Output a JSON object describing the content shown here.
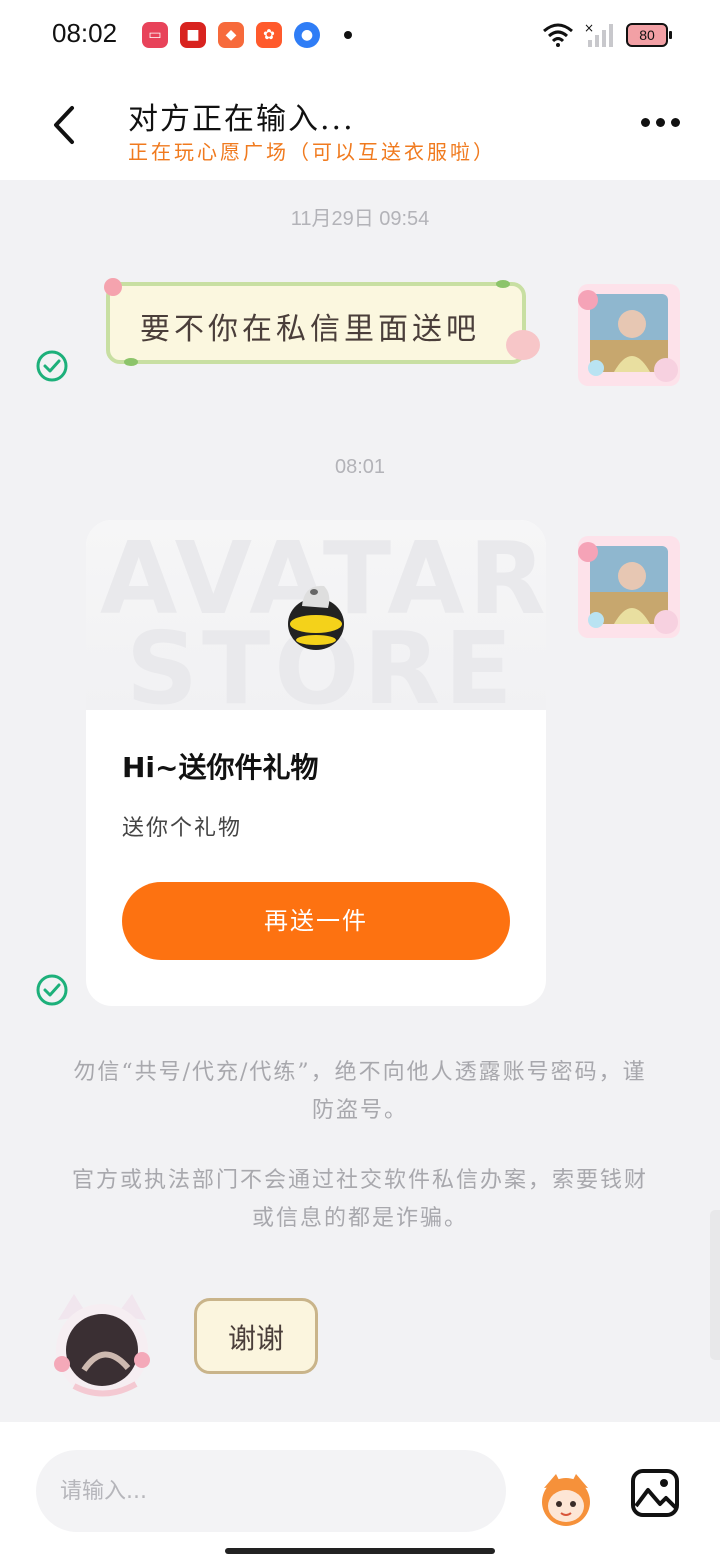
{
  "status_bar": {
    "time": "08:02",
    "battery": "80",
    "notifications": [
      "video-app-icon",
      "red-packet-icon",
      "game-app-icon",
      "photo-app-icon",
      "browser-app-icon"
    ]
  },
  "header": {
    "title": "对方正在输入...",
    "subtitle": "正在玩心愿广场（可以互送衣服啦）"
  },
  "messages": {
    "timestamp_1": "11月29日 09:54",
    "sticker_text": "要不你在私信里面送吧",
    "timestamp_2": "08:01",
    "gift_card": {
      "banner_text_1": "AVATAR",
      "banner_text_2": "STORE",
      "title": "Hi~送你件礼物",
      "description": "送你个礼物",
      "button_label": "再送一件"
    },
    "warning_1": "勿信“共号/代充/代练”，绝不向他人透露账号密码，谨防盗号。",
    "warning_2": "官方或执法部门不会通过社交软件私信办案，索要钱财或信息的都是诈骗。",
    "thanks_sticker_text": "谢谢"
  },
  "input": {
    "placeholder": "请输入..."
  },
  "colors": {
    "accent": "#fd7211",
    "subtitle": "#f07a1e",
    "check": "#1db07a"
  }
}
